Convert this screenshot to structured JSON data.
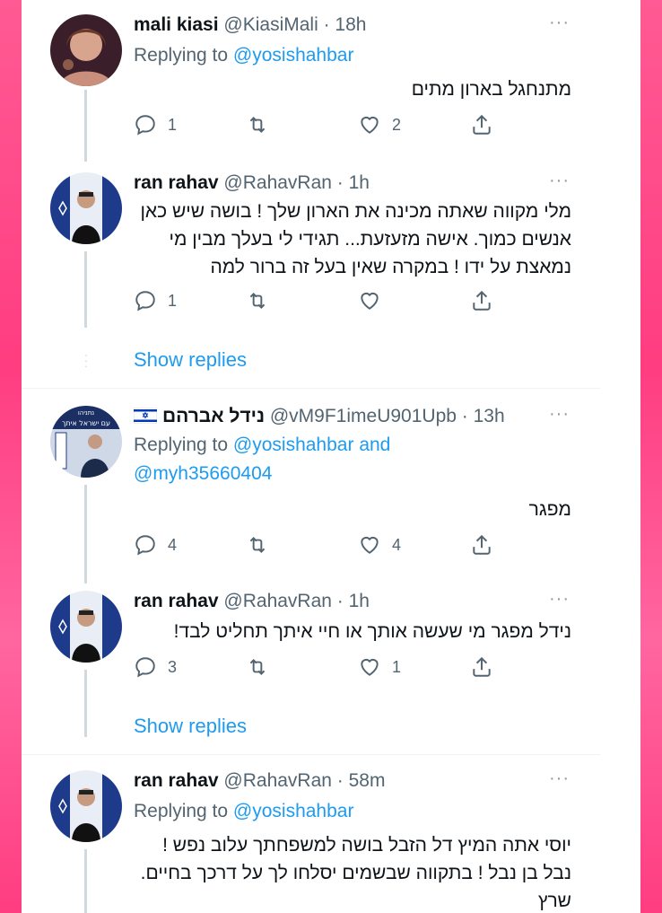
{
  "tweets": [
    {
      "name": "mali kiasi",
      "handle": "@KiasiMali",
      "time": "· 18h",
      "replying_label": "Replying to",
      "replying_handle": "@yosishahbar",
      "text": "מתנחגל בארון מתים",
      "replies": "1",
      "retweets": "",
      "likes": "2"
    },
    {
      "name": "ran rahav",
      "handle": "@RahavRan",
      "time": "· 1h",
      "text": "מלי מקווה שאתה מכינה את הארון שלך ! בושה שיש כאן אנשים כמוך. אישה מזעזעת... תגידי לי בעלך מבין מי נמאצת על ידו ! במקרה שאין בעל זה ברור למה",
      "replies": "1",
      "retweets": "",
      "likes": ""
    },
    {
      "name": "נידל אברהם",
      "handle": "@vM9F1imeU901Upb",
      "time": "· 13h",
      "replying_label": "Replying to",
      "replying_handle": "@yosishahbar",
      "replying_and": "and",
      "replying_handle2": "@myh35660404",
      "text": "מפגר",
      "replies": "4",
      "retweets": "",
      "likes": "4",
      "avatar_text_top": "נתניהו",
      "avatar_text_bottom": "עם ישראל איתך"
    },
    {
      "name": "ran rahav",
      "handle": "@RahavRan",
      "time": "· 1h",
      "text": "נידל  מפגר מי שעשה אותך או חיי איתך תחליט לבד!",
      "replies": "3",
      "retweets": "",
      "likes": "1"
    },
    {
      "name": "ran rahav",
      "handle": "@RahavRan",
      "time": "· 58m",
      "replying_label": "Replying to",
      "replying_handle": "@yosishahbar",
      "text": "יוסי אתה המיץ דל הזבל  בושה למשפחתך עלוב נפש ! נבל בן נבל ! בתקווה שבשמים יסלחו לך על דרכך בחיים. שרץ"
    }
  ],
  "show_replies": "Show replies",
  "more": "···",
  "colors": {
    "accent": "#1d9bf0",
    "text": "#0f1419",
    "muted": "#536471",
    "frame": "#ff4f8b"
  }
}
